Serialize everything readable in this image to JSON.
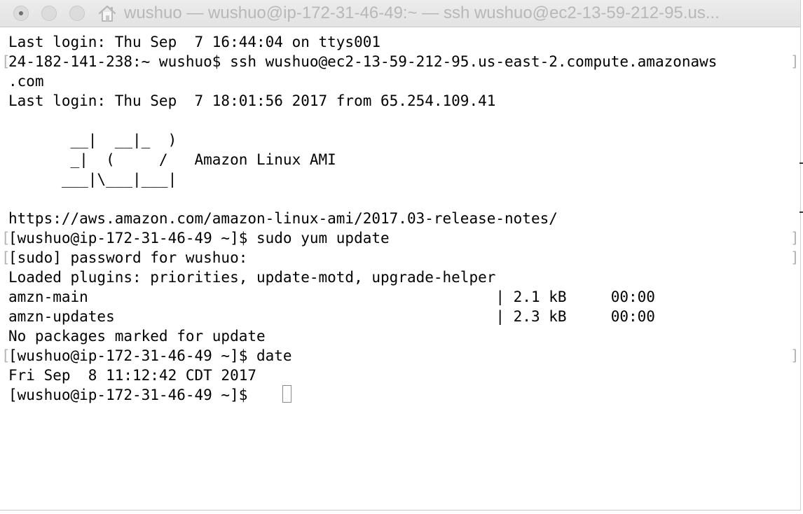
{
  "window": {
    "title": "wushuo — wushuo@ip-172-31-46-49:~ — ssh wushuo@ec2-13-59-212-95.us..."
  },
  "terminal": {
    "lines": [
      "Last login: Thu Sep  7 16:44:04 on ttys001",
      "24-182-141-238:~ wushuo$ ssh wushuo@ec2-13-59-212-95.us-east-2.compute.amazonaws",
      ".com",
      "Last login: Thu Sep  7 18:01:56 2017 from 65.254.109.41",
      "",
      "       __|  __|_  )",
      "       _|  (     /   Amazon Linux AMI",
      "      ___|\\___|___|",
      "",
      "https://aws.amazon.com/amazon-linux-ami/2017.03-release-notes/",
      "[wushuo@ip-172-31-46-49 ~]$ sudo yum update",
      "[sudo] password for wushuo:",
      "Loaded plugins: priorities, update-motd, upgrade-helper",
      "amzn-main                                              | 2.1 kB     00:00",
      "amzn-updates                                           | 2.3 kB     00:00",
      "No packages marked for update",
      "[wushuo@ip-172-31-46-49 ~]$ date",
      "Fri Sep  8 11:12:42 CDT 2017",
      "[wushuo@ip-172-31-46-49 ~]$ "
    ]
  },
  "icons": {
    "home": "home-icon",
    "cursor": "terminal-cursor"
  },
  "colors": {
    "title_text": "#b8b8b8",
    "terminal_text": "#000000",
    "background": "#ffffff"
  }
}
